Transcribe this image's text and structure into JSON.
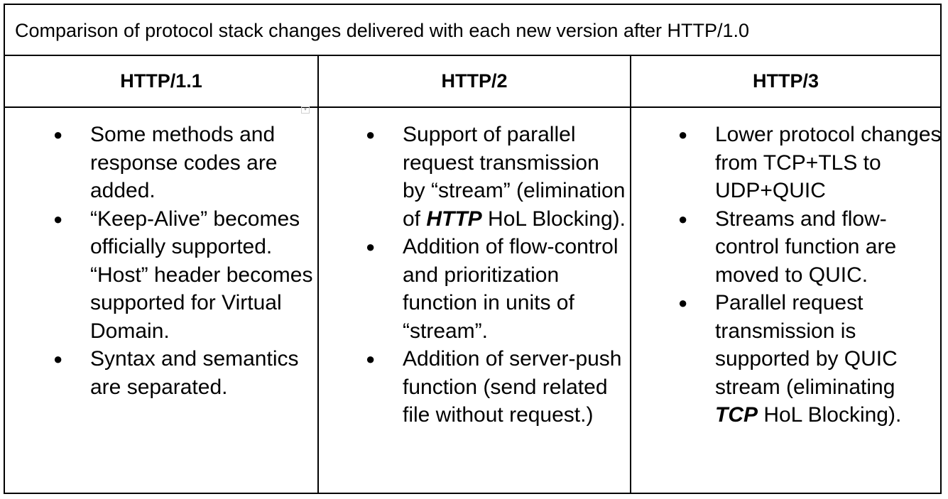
{
  "caption": "Comparison of protocol stack changes delivered with each new version after HTTP/1.0",
  "columns": [
    {
      "header": "HTTP/1.1",
      "items": [
        [
          {
            "text": "Some methods and response codes are added."
          }
        ],
        [
          {
            "text": "“Keep-Alive” becomes officially supported. “Host” header becomes supported for Virtual Domain."
          }
        ],
        [
          {
            "text": "Syntax and semantics are separated."
          }
        ]
      ]
    },
    {
      "header": "HTTP/2",
      "items": [
        [
          {
            "text": "Support of parallel request transmission by “stream” (elimination of "
          },
          {
            "text": "HTTP",
            "emph": true
          },
          {
            "text": " HoL Blocking)."
          }
        ],
        [
          {
            "text": "Addition of flow-control and prioritization function in units of “stream”."
          }
        ],
        [
          {
            "text": "Addition of server-push function (send related file without request.)"
          }
        ]
      ]
    },
    {
      "header": "HTTP/3",
      "items": [
        [
          {
            "text": "Lower protocol changes from TCP+TLS to UDP+QUIC"
          }
        ],
        [
          {
            "text": "Streams and flow-control function are moved to QUIC."
          }
        ],
        [
          {
            "text": "Parallel request transmission is supported by QUIC stream (eliminating "
          },
          {
            "text": "TCP",
            "emph": true
          },
          {
            "text": " HoL Blocking)."
          }
        ]
      ]
    }
  ],
  "bullet_glyph": "●",
  "dropdown_marker_icon": "▾"
}
